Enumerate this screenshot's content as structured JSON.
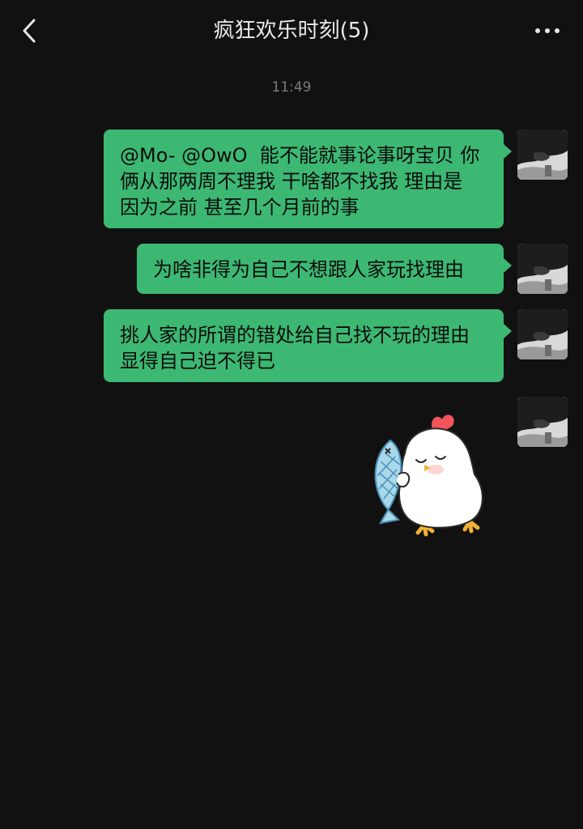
{
  "header": {
    "title": "疯狂欢乐时刻(5)",
    "back_icon": "chevron-left-icon",
    "more_icon": "more-dots-icon"
  },
  "chat": {
    "timestamp": "11:49",
    "bubble_color": "#3cb872",
    "messages": [
      {
        "type": "text",
        "text": "@Mo- @OwO  能不能就事论事呀宝贝 你\n俩从那两周不理我 干啥都不找我 理由是\n因为之前 甚至几个月前的事"
      },
      {
        "type": "text",
        "text": "为啥非得为自己不想跟人家玩找理由"
      },
      {
        "type": "text",
        "text": "挑人家的所谓的错处给自己找不玩的理由\n显得自己迫不得已"
      },
      {
        "type": "sticker",
        "sticker": "chick-holding-fish-sticker"
      }
    ]
  },
  "colors": {
    "background": "#111111",
    "bubble": "#3cb872",
    "title_text": "#e9e9e9",
    "timestamp_text": "#7c7c7c"
  }
}
